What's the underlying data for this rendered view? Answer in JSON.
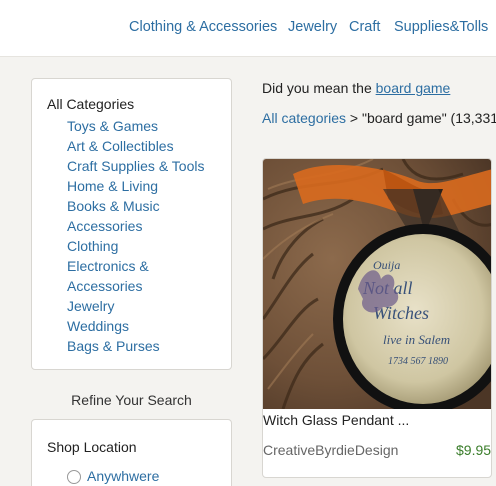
{
  "topnav": {
    "items": [
      "Clothing & Accessories",
      "Jewelry",
      "Craft",
      "Supplies&Tolls"
    ]
  },
  "categories": {
    "all_label": "All Categories",
    "items": [
      "Toys & Games",
      "Art & Collectibles",
      "Craft Supplies & Tools",
      "Home & Living",
      "Books & Music",
      "Accessories",
      "Clothing",
      "Electronics &",
      "Accessories",
      "Jewelry",
      "Weddings",
      "Bags & Purses"
    ]
  },
  "refine": {
    "label": "Refine Your Search"
  },
  "shop_location": {
    "title": "Shop Location",
    "option": "Anywhwere"
  },
  "search": {
    "did_you_mean_prefix": "Did you mean the ",
    "suggestion": "board game",
    "crumb_link": "All categories",
    "crumb_rest": " > \"board game\" (13,331"
  },
  "product": {
    "title": "Witch Glass Pendant ...",
    "shop": "CreativeByrdieDesign",
    "price": "$9.95",
    "image_name": "witch-glass-pendant-photo"
  },
  "colors": {
    "link": "#2d6ea2",
    "price": "#3a7d2a",
    "background": "#f4f3f0"
  }
}
